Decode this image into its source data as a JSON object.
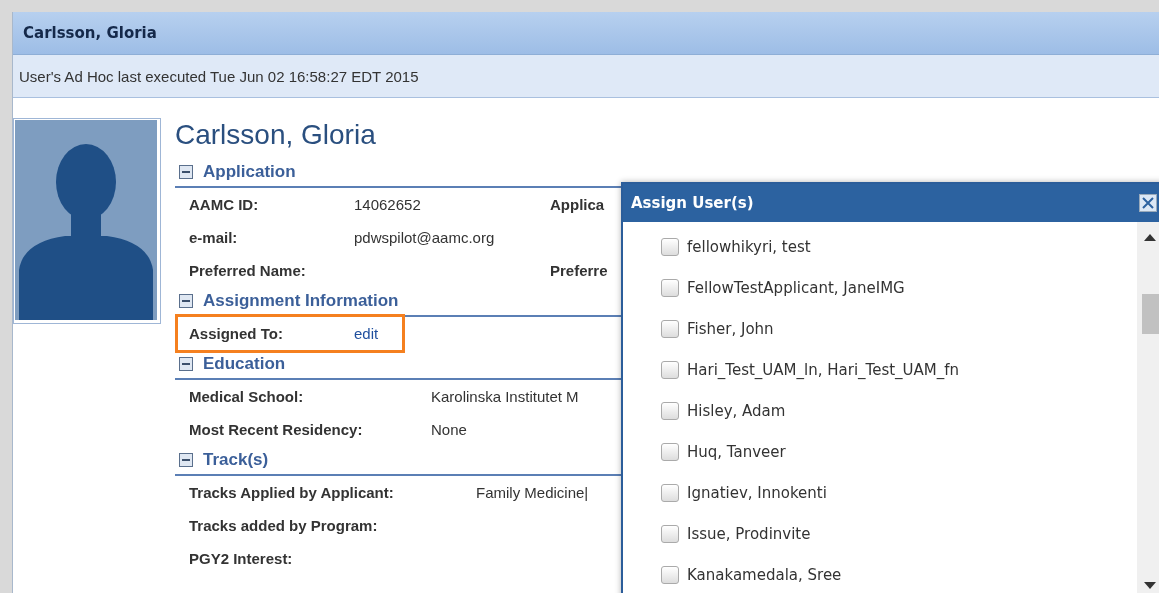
{
  "window": {
    "title": "Carlsson, Gloria"
  },
  "status": "User's Ad Hoc last executed Tue Jun 02 16:58:27 EDT 2015",
  "profile": {
    "name": "Carlsson, Gloria"
  },
  "sections": [
    {
      "title": "Application",
      "rows": [
        [
          {
            "label": "AAMC ID:",
            "value": "14062652"
          },
          {
            "label": "Applica"
          }
        ],
        [
          {
            "label": "e-mail:",
            "value": "pdwspilot@aamc.org"
          }
        ],
        [
          {
            "label": "Preferred Name:"
          },
          {
            "label": "Preferre"
          }
        ]
      ]
    },
    {
      "title": "Assignment Information",
      "highlighted": true,
      "rows": [
        [
          {
            "label": "Assigned To:",
            "link": "edit"
          }
        ]
      ]
    },
    {
      "title": "Education",
      "rows": [
        [
          {
            "label": "Medical School:",
            "value": "Karolinska Institutet M"
          }
        ],
        [
          {
            "label": "Most Recent Residency:",
            "value": "None"
          }
        ]
      ]
    },
    {
      "title": "Track(s)",
      "rows": [
        [
          {
            "label": "Tracks Applied by Applicant:",
            "value": "Family Medicine|"
          }
        ],
        [
          {
            "label": "Tracks added by Program:"
          }
        ],
        [
          {
            "label": "PGY2 Interest:"
          }
        ]
      ]
    }
  ],
  "dialog": {
    "title": "Assign User(s)",
    "users": [
      {
        "name": "fellowhikyri, test",
        "checked": false
      },
      {
        "name": "FellowTestApplicant, JaneIMG",
        "checked": false
      },
      {
        "name": "Fisher, John",
        "checked": false
      },
      {
        "name": "Hari_Test_UAM_ln, Hari_Test_UAM_fn",
        "checked": false
      },
      {
        "name": "Hisley, Adam",
        "checked": false
      },
      {
        "name": "Huq, Tanveer",
        "checked": false
      },
      {
        "name": "Ignatiev, Innokenti",
        "checked": false
      },
      {
        "name": "Issue, Prodinvite",
        "checked": false
      },
      {
        "name": "Kanakamedala, Sree",
        "checked": false
      }
    ]
  }
}
